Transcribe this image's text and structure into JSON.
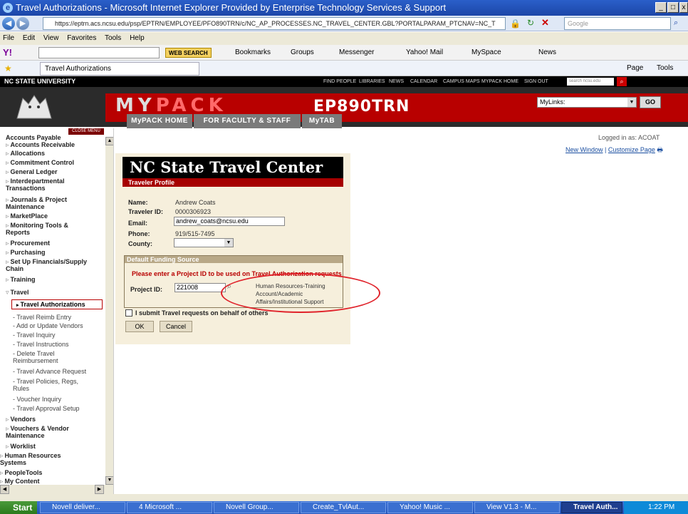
{
  "window": {
    "title": "Travel Authorizations - Microsoft Internet Explorer Provided by Enterprise Technology Services & Support"
  },
  "browser": {
    "url": "https://eptrn.acs.ncsu.edu/psp/EPTRN/EMPLOYEE/PFO890TRN/c/NC_AP_PROCESSES.NC_TRAVEL_CENTER.GBL?PORTALPARAM_PTCNAV=NC_T",
    "search_placeholder": "Google",
    "menu": [
      "File",
      "Edit",
      "View",
      "Favorites",
      "Tools",
      "Help"
    ],
    "yahoo_toolbar": {
      "search_button": "WEB SEARCH",
      "items": [
        "Bookmarks",
        "Groups",
        "Messenger",
        "Yahoo! Mail",
        "MySpace",
        "News"
      ]
    },
    "tab_title": "Travel Authorizations",
    "command_bar": [
      "Page",
      "Tools"
    ]
  },
  "portal": {
    "university": "NC STATE UNIVERSITY",
    "top_links": [
      "FIND PEOPLE",
      "LIBRARIES",
      "NEWS",
      "CALENDAR",
      "CAMPUS MAPS",
      "MYPACK HOME",
      "SIGN OUT"
    ],
    "search_placeholder": "search ncsu.edu",
    "logo": {
      "my": "MY",
      "pack": "PACK"
    },
    "server": "EP890TRN",
    "mylinks_value": "MyLinks:",
    "go_label": "GO",
    "nav_tabs": [
      "MyPACK HOME",
      "FOR FACULTY & STAFF",
      "MyTAB"
    ],
    "logged_in": "Logged in as: ACOAT",
    "page_links": [
      "New Window",
      "Customize Page"
    ]
  },
  "sidebar": {
    "close_menu": "CLOSE MENU",
    "items": [
      {
        "label": "Accounts Payable",
        "level": 0
      },
      {
        "label": "Accounts Receivable",
        "level": 0
      },
      {
        "label": "Allocations",
        "level": 0
      },
      {
        "label": "Commitment Control",
        "level": 0
      },
      {
        "label": "General Ledger",
        "level": 0
      },
      {
        "label": "Interdepartmental Transactions",
        "level": 0
      },
      {
        "label": "Journals & Project Maintenance",
        "level": 0
      },
      {
        "label": "MarketPlace",
        "level": 0
      },
      {
        "label": "Monitoring Tools & Reports",
        "level": 0
      },
      {
        "label": "Procurement",
        "level": 0
      },
      {
        "label": "Purchasing",
        "level": 0
      },
      {
        "label": "Set Up Financials/Supply Chain",
        "level": 0
      },
      {
        "label": "Training",
        "level": 0
      },
      {
        "label": "Travel",
        "level": 0
      },
      {
        "label": "Travel Authorizations",
        "level": 1,
        "selected": true
      },
      {
        "label": "Travel Reimb Entry",
        "level": 1
      },
      {
        "label": "Add or Update Vendors",
        "level": 1
      },
      {
        "label": "Travel Inquiry",
        "level": 1
      },
      {
        "label": "Travel Instructions",
        "level": 1
      },
      {
        "label": "Delete Travel Reimbursement",
        "level": 1
      },
      {
        "label": "Travel Advance Request",
        "level": 1
      },
      {
        "label": "Travel Policies, Regs, Rules",
        "level": 1
      },
      {
        "label": "Voucher Inquiry",
        "level": 1
      },
      {
        "label": "Travel Approval Setup",
        "level": 1
      },
      {
        "label": "Vendors",
        "level": 0
      },
      {
        "label": "Vouchers & Vendor Maintenance",
        "level": 0
      },
      {
        "label": "Worklist",
        "level": 0
      },
      {
        "label": "Human Resources Systems",
        "level": 0
      },
      {
        "label": "PeopleTools",
        "level": 0
      },
      {
        "label": "My Content",
        "level": 0
      }
    ]
  },
  "form": {
    "title": "NC State Travel Center",
    "subtitle": "Traveler Profile",
    "name_label": "Name:",
    "name_value": "Andrew  Coats",
    "id_label": "Traveler ID:",
    "id_value": "0000306923",
    "email_label": "Email:",
    "email_value": "andrew_coats@ncsu.edu",
    "phone_label": "Phone:",
    "phone_value": "919/515-7495",
    "county_label": "County:",
    "county_value": "",
    "funding_header": "Default Funding Source",
    "funding_warning": "Please enter a Project ID to be used on Travel Authorization requests",
    "project_label": "Project ID:",
    "project_value": "221008",
    "project_desc": "Human Resources-Training Account/Academic Affairs/Institutional Support",
    "behalf_label": "I submit Travel requests on behalf of others",
    "ok_label": "OK",
    "cancel_label": "Cancel",
    "highlight_color": "#e0222a"
  },
  "taskbar": {
    "start": "Start",
    "items": [
      "Novell deliver...",
      "4 Microsoft ...",
      "Novell Group...",
      "Create_TvlAut...",
      "Yahoo! Music ...",
      "View V1.3 - M...",
      "Travel Auth..."
    ],
    "clock": "1:22 PM"
  }
}
